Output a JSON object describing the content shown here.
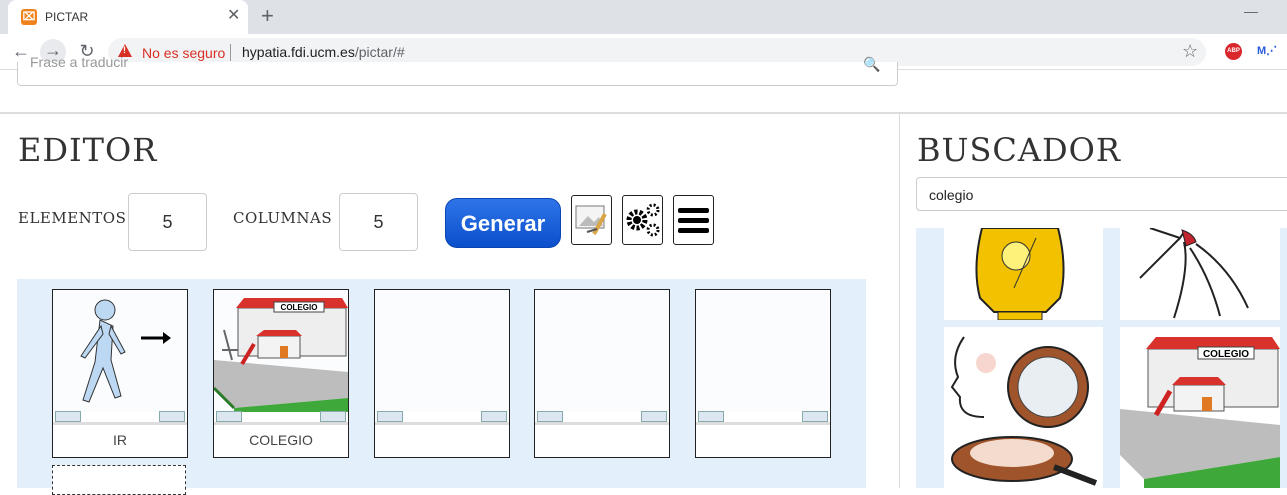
{
  "browser": {
    "tab_title": "PICTAR",
    "tab_favicon": "xampp-icon",
    "security_label": "No es seguro",
    "url_host": "hypatia.fdi.ucm.es",
    "url_path": "/pictar/#",
    "extensions": [
      "ABP",
      "M"
    ]
  },
  "top_search": {
    "placeholder": "Frase a traducir"
  },
  "editor": {
    "heading": "EDITOR",
    "elementos_label": "ELEMENTOS",
    "elementos_value": "5",
    "columnas_label": "COLUMNAS",
    "columnas_value": "5",
    "generate_label": "Generar",
    "cards": [
      {
        "word": "IR",
        "picto": "walking-person-picto"
      },
      {
        "word": "COLEGIO",
        "picto": "school-picto"
      },
      {
        "word": "",
        "picto": ""
      },
      {
        "word": "",
        "picto": ""
      },
      {
        "word": "",
        "picto": ""
      }
    ]
  },
  "buscador": {
    "heading": "BUSCADOR",
    "query": "colegio",
    "school_sign": "COLEGIO",
    "results": [
      "perfume-picto",
      "hair-tie-picto",
      "makeup-compact-picto",
      "school-picto"
    ]
  },
  "colors": {
    "accent": "#0b4fcc",
    "board_bg": "#e3f0fb",
    "warning": "#d93025"
  }
}
